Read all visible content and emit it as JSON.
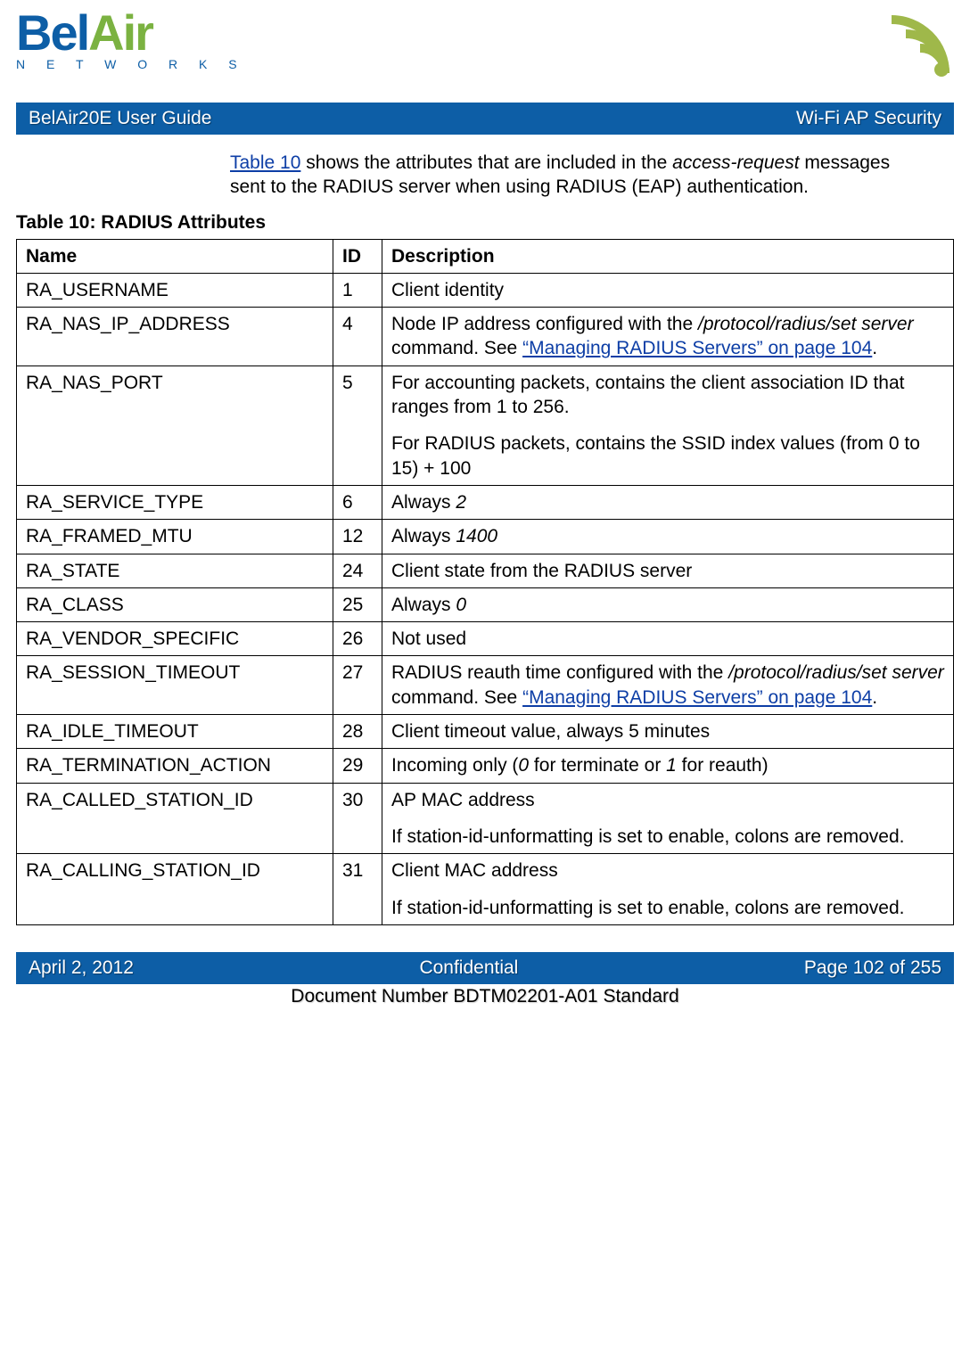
{
  "logo": {
    "part1": "Bel",
    "part2": "Air",
    "sub": "N E T W O R K S"
  },
  "header_bar": {
    "left": "BelAir20E User Guide",
    "right": "Wi-Fi AP Security"
  },
  "intro": {
    "link": "Table 10",
    "t1": " shows the attributes that are included in the ",
    "it1": "access-request",
    "t2": " messages sent to the RADIUS server when using RADIUS (EAP) authentication."
  },
  "caption": "Table 10: RADIUS Attributes",
  "th": {
    "name": "Name",
    "id": "ID",
    "desc": "Description"
  },
  "rows": [
    {
      "name": "RA_USERNAME",
      "id": "1",
      "desc": [
        {
          "runs": [
            {
              "t": "Client identity"
            }
          ]
        }
      ]
    },
    {
      "name": "RA_NAS_IP_ADDRESS",
      "id": "4",
      "desc": [
        {
          "runs": [
            {
              "t": "Node IP address configured with the "
            },
            {
              "t": "/protocol/radius/set server",
              "style": "italic"
            },
            {
              "t": " command. See "
            },
            {
              "t": "“Managing RADIUS Servers” on page 104",
              "style": "link"
            },
            {
              "t": "."
            }
          ]
        }
      ]
    },
    {
      "name": "RA_NAS_PORT",
      "id": "5",
      "desc": [
        {
          "runs": [
            {
              "t": "For accounting packets, contains the client association ID that ranges from 1 to 256."
            }
          ]
        },
        {
          "runs": [
            {
              "t": "For RADIUS packets, contains the SSID index values (from 0 to 15) + 100"
            }
          ]
        }
      ]
    },
    {
      "name": "RA_SERVICE_TYPE",
      "id": "6",
      "desc": [
        {
          "runs": [
            {
              "t": "Always "
            },
            {
              "t": "2",
              "style": "italic"
            }
          ]
        }
      ]
    },
    {
      "name": "RA_FRAMED_MTU",
      "id": "12",
      "desc": [
        {
          "runs": [
            {
              "t": "Always "
            },
            {
              "t": "1400",
              "style": "italic"
            }
          ]
        }
      ]
    },
    {
      "name": "RA_STATE",
      "id": "24",
      "desc": [
        {
          "runs": [
            {
              "t": "Client state from the RADIUS server"
            }
          ]
        }
      ]
    },
    {
      "name": "RA_CLASS",
      "id": "25",
      "desc": [
        {
          "runs": [
            {
              "t": "Always "
            },
            {
              "t": "0",
              "style": "italic"
            }
          ]
        }
      ]
    },
    {
      "name": "RA_VENDOR_SPECIFIC",
      "id": "26",
      "desc": [
        {
          "runs": [
            {
              "t": "Not used"
            }
          ]
        }
      ]
    },
    {
      "name": "RA_SESSION_TIMEOUT",
      "id": "27",
      "desc": [
        {
          "runs": [
            {
              "t": "RADIUS reauth time configured with the "
            },
            {
              "t": "/protocol/radius/set server",
              "style": "italic"
            },
            {
              "t": " command. See "
            },
            {
              "t": "“Managing RADIUS Servers” on page 104",
              "style": "link"
            },
            {
              "t": "."
            }
          ]
        }
      ]
    },
    {
      "name": "RA_IDLE_TIMEOUT",
      "id": "28",
      "desc": [
        {
          "runs": [
            {
              "t": "Client timeout value, always 5 minutes"
            }
          ]
        }
      ]
    },
    {
      "name": "RA_TERMINATION_ACTION",
      "id": "29",
      "desc": [
        {
          "runs": [
            {
              "t": "Incoming only ("
            },
            {
              "t": "0",
              "style": "italic"
            },
            {
              "t": " for terminate or "
            },
            {
              "t": "1",
              "style": "italic"
            },
            {
              "t": " for reauth)"
            }
          ]
        }
      ]
    },
    {
      "name": "RA_CALLED_STATION_ID",
      "id": "30",
      "desc": [
        {
          "runs": [
            {
              "t": "AP MAC address"
            }
          ]
        },
        {
          "runs": [
            {
              "t": "If station-id-unformatting is set to enable, colons are removed."
            }
          ]
        }
      ]
    },
    {
      "name": "RA_CALLING_STATION_ID",
      "id": "31",
      "desc": [
        {
          "runs": [
            {
              "t": "Client MAC address"
            }
          ]
        },
        {
          "runs": [
            {
              "t": "If station-id-unformatting is set to enable, colons are removed."
            }
          ]
        }
      ]
    }
  ],
  "footer_bar": {
    "left": "April 2, 2012",
    "center": "Confidential",
    "right": "Page 102 of 255"
  },
  "doc_num": "Document Number BDTM02201-A01 Standard"
}
